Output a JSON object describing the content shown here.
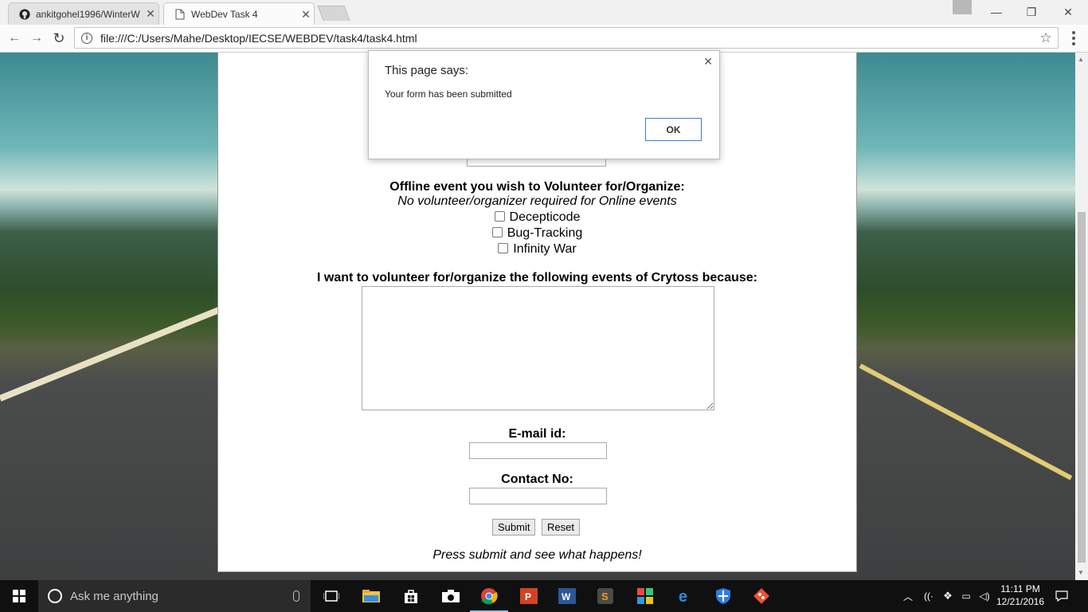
{
  "browser": {
    "tabs": [
      {
        "title": "ankitgohel1996/WinterW",
        "icon": "github-icon"
      },
      {
        "title": "WebDev Task 4",
        "icon": "document-icon"
      }
    ],
    "url": "file:///C:/Users/Mahe/Desktop/IECSE/WEBDEV/task4/task4.html"
  },
  "form": {
    "event_label": "Offline event you wish to Volunteer for/Organize:",
    "event_note": "No volunteer/organizer required for Online events",
    "events": [
      "Decepticode",
      "Bug-Tracking",
      "Infinity War"
    ],
    "reason_label": "I want to volunteer for/organize the following events of Crytoss because:",
    "email_label": "E-mail id:",
    "contact_label": "Contact No:",
    "submit": "Submit",
    "reset": "Reset",
    "tagline": "Press submit and see what happens!"
  },
  "dialog": {
    "title": "This page says:",
    "message": "Your form has been submitted",
    "ok": "OK"
  },
  "taskbar": {
    "search_placeholder": "Ask me anything",
    "time": "11:11 PM",
    "date": "12/21/2016"
  }
}
